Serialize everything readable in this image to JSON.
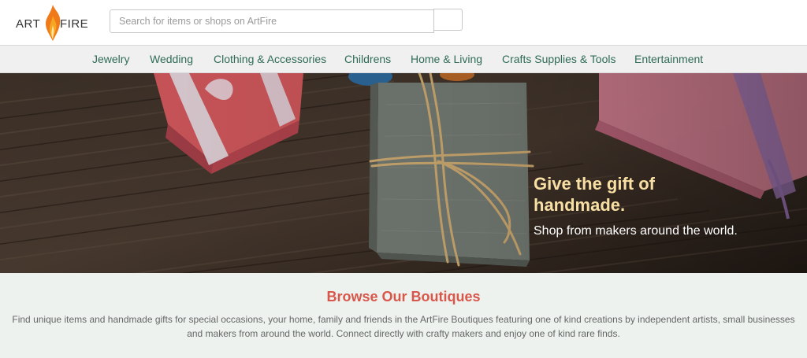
{
  "header": {
    "logo": {
      "art": "ART",
      "fire": "FIRE"
    },
    "search": {
      "placeholder": "Search for items or shops on ArtFire"
    }
  },
  "nav": {
    "items": [
      {
        "label": "Jewelry"
      },
      {
        "label": "Wedding"
      },
      {
        "label": "Clothing & Accessories"
      },
      {
        "label": "Childrens"
      },
      {
        "label": "Home & Living"
      },
      {
        "label": "Crafts Supplies & Tools"
      },
      {
        "label": "Entertainment"
      }
    ]
  },
  "hero": {
    "headline": "Give the gift of handmade.",
    "subline": "Shop from makers around the world."
  },
  "boutiques": {
    "title": "Browse Our Boutiques",
    "description": "Find unique items and handmade gifts for special occasions, your home, family and friends in the ArtFire Boutiques featuring one of kind creations by independent artists, small businesses and makers from around the world. Connect directly with crafty makers and enjoy one of kind rare finds."
  },
  "colors": {
    "nav_text": "#2f6b56",
    "headline": "#f8dfa4",
    "section_title": "#d9574a",
    "flame": "#f07a1a"
  }
}
